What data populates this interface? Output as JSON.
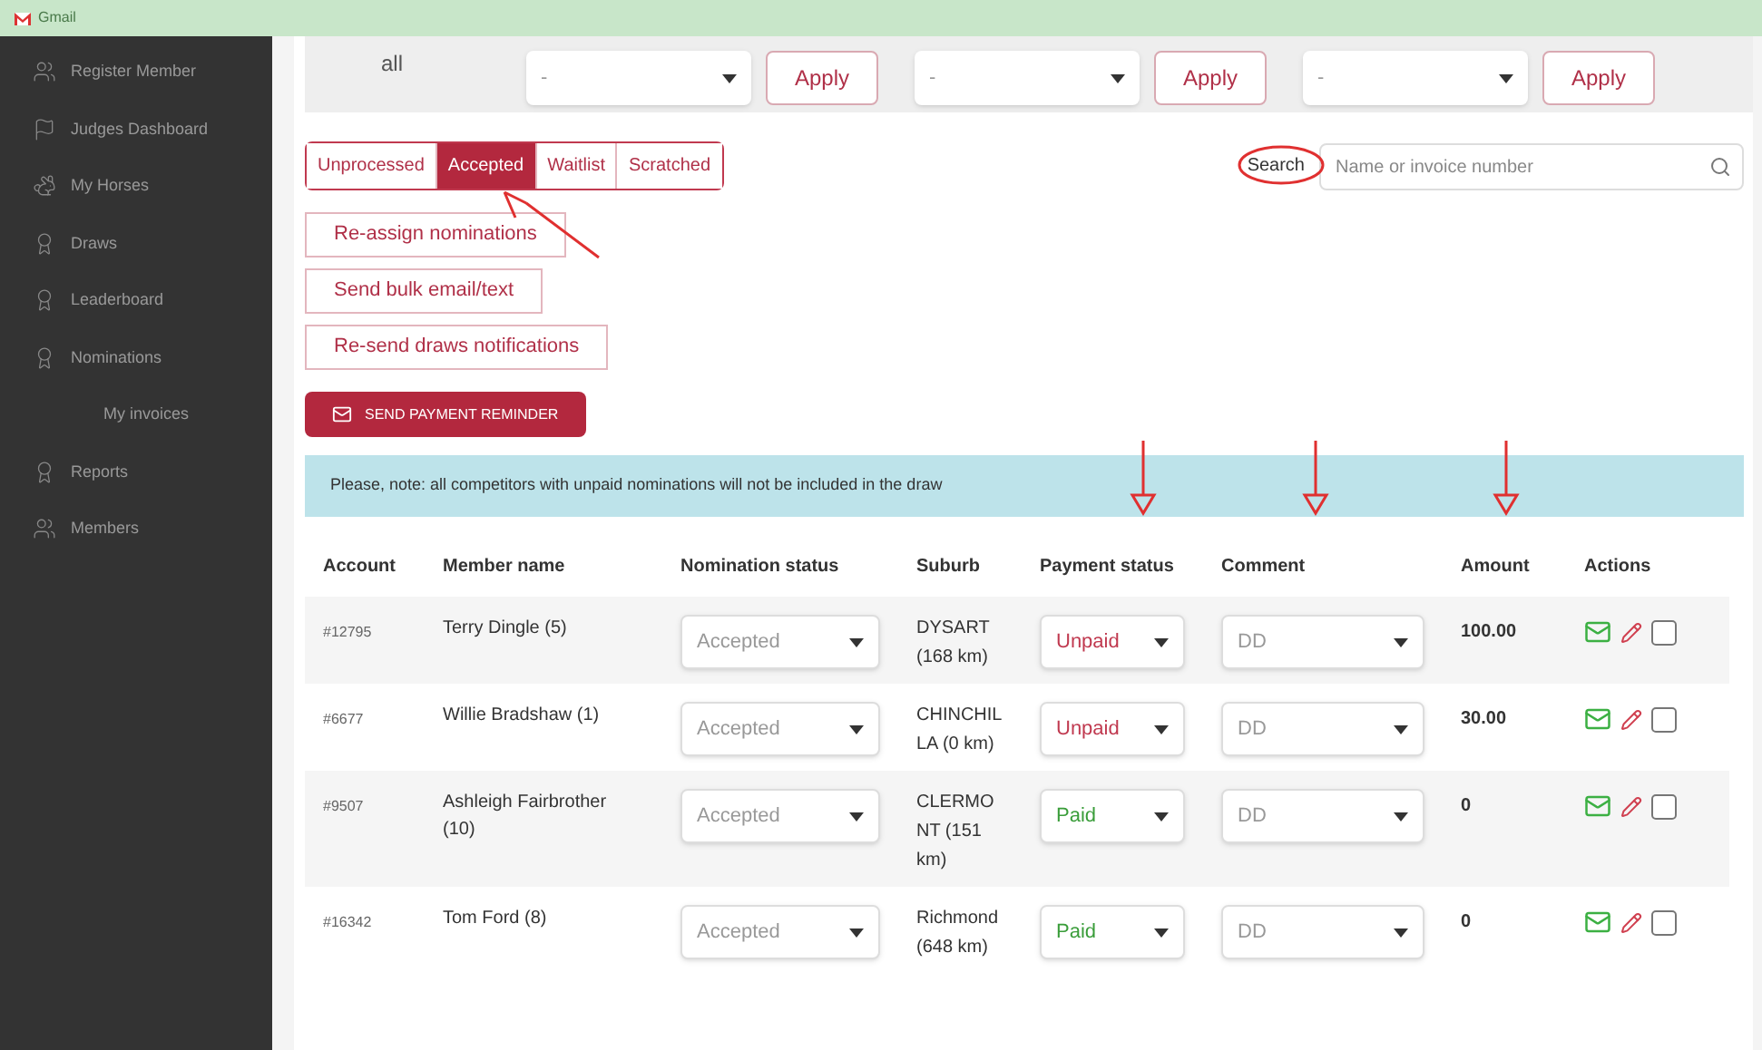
{
  "bookmarks_bar": {
    "items": [
      {
        "label": "Gmail"
      }
    ]
  },
  "sidebar": {
    "items": [
      {
        "label": "Register Member"
      },
      {
        "label": "Judges Dashboard"
      },
      {
        "label": "My Horses"
      },
      {
        "label": "Draws"
      },
      {
        "label": "Leaderboard"
      },
      {
        "label": "Nominations",
        "children": [
          {
            "label": "My invoices"
          }
        ]
      },
      {
        "label": "Reports"
      },
      {
        "label": "Members"
      }
    ]
  },
  "filter_bar": {
    "label": "all",
    "groups": [
      {
        "value": "-",
        "button": "Apply"
      },
      {
        "value": "-",
        "button": "Apply"
      },
      {
        "value": "-",
        "button": "Apply"
      }
    ]
  },
  "tabs": [
    {
      "label": "Unprocessed",
      "selected": false
    },
    {
      "label": "Accepted",
      "selected": true
    },
    {
      "label": "Waitlist",
      "selected": false
    },
    {
      "label": "Scratched",
      "selected": false
    }
  ],
  "search": {
    "label": "Search",
    "placeholder": "Name or invoice number"
  },
  "actions": [
    "Re-assign nominations",
    "Send bulk email/text",
    "Re-send draws notifications"
  ],
  "reminder_button": "SEND PAYMENT REMINDER",
  "notice": "Please, note: all competitors with unpaid nominations will not be included in the draw",
  "table": {
    "columns": [
      "Account",
      "Member name",
      "Nomination status",
      "Suburb",
      "Payment status",
      "Comment",
      "Amount",
      "Actions"
    ],
    "rows": [
      {
        "account": "#12795",
        "member": "Terry Dingle (5)",
        "nomination": "Accepted",
        "suburb": "DYSART (168 km)",
        "payment": {
          "value": "Unpaid",
          "kind": "unpaid"
        },
        "comment": "DD",
        "amount": "100.00",
        "checked": false
      },
      {
        "account": "#6677",
        "member": "Willie Bradshaw (1)",
        "nomination": "Accepted",
        "suburb": "CHINCHILLA (0 km)",
        "payment": {
          "value": "Unpaid",
          "kind": "unpaid"
        },
        "comment": "DD",
        "amount": "30.00",
        "checked": false
      },
      {
        "account": "#9507",
        "member": "Ashleigh Fairbrother (10)",
        "nomination": "Accepted",
        "suburb": "CLERMONT (151 km)",
        "payment": {
          "value": "Paid",
          "kind": "paid"
        },
        "comment": "DD",
        "amount": "0",
        "checked": false
      },
      {
        "account": "#16342",
        "member": "Tom Ford (8)",
        "nomination": "Accepted",
        "suburb": "Richmond (648 km)",
        "payment": {
          "value": "Paid",
          "kind": "paid"
        },
        "comment": "DD",
        "amount": "0",
        "checked": false
      }
    ]
  }
}
